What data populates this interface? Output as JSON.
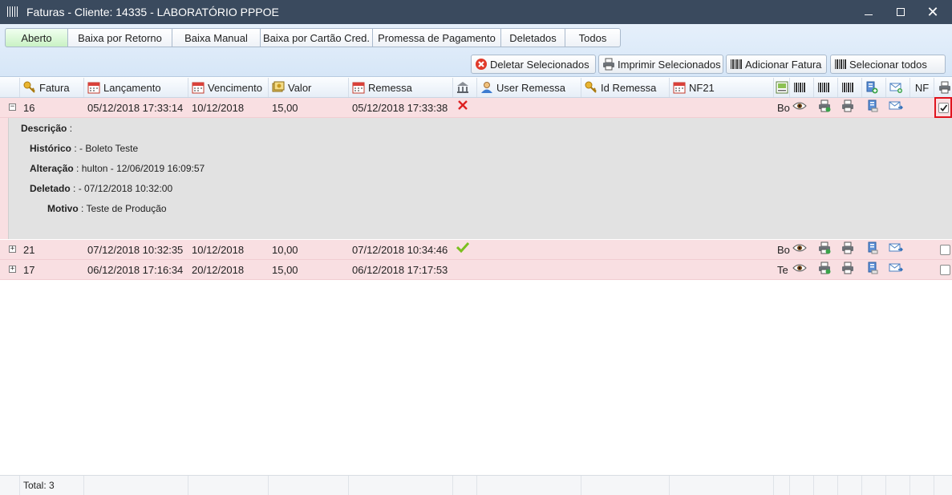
{
  "window": {
    "title": "Faturas - Cliente: 14335 - LABORATÓRIO PPPOE"
  },
  "tabs": [
    {
      "label": "Aberto",
      "active": true
    },
    {
      "label": "Baixa por Retorno"
    },
    {
      "label": "Baixa Manual"
    },
    {
      "label": "Baixa por Cartão Cred."
    },
    {
      "label": "Promessa de Pagamento"
    },
    {
      "label": "Deletados"
    },
    {
      "label": "Todos"
    }
  ],
  "actions": {
    "delete": "Deletar Selecionados",
    "print": "Imprimir Selecionados",
    "add": "Adicionar Fatura",
    "select_all": "Selecionar todos"
  },
  "columns": {
    "fatura": "Fatura",
    "lancamento": "Lançamento",
    "vencimento": "Vencimento",
    "valor": "Valor",
    "remessa": "Remessa",
    "user_remessa": "User Remessa",
    "id_remessa": "Id Remessa",
    "nf21": "NF21",
    "nf": "NF"
  },
  "rows": [
    {
      "fatura": "16",
      "lancamento": "05/12/2018 17:33:14",
      "vencimento": "10/12/2018",
      "valor": "15,00",
      "remessa": "05/12/2018 17:33:38",
      "status_icon": "red-x-icon",
      "desc_short": "Bo",
      "expanded": true,
      "checked": true
    },
    {
      "fatura": "21",
      "lancamento": "07/12/2018 10:32:35",
      "vencimento": "10/12/2018",
      "valor": "10,00",
      "remessa": "07/12/2018 10:34:46",
      "status_icon": "green-check-icon",
      "desc_short": "Bo",
      "expanded": false,
      "checked": false
    },
    {
      "fatura": "17",
      "lancamento": "06/12/2018 17:16:34",
      "vencimento": "20/12/2018",
      "valor": "15,00",
      "remessa": "06/12/2018 17:17:53",
      "status_icon": "",
      "desc_short": "Te",
      "expanded": false,
      "checked": false
    }
  ],
  "detail": {
    "descricao_label": "Descrição",
    "descricao_value": "",
    "historico_label": "Histórico",
    "historico_value": "- Boleto Teste",
    "alteracao_label": "Alteração",
    "alteracao_value": "hulton - 12/06/2019 16:09:57",
    "deletado_label": "Deletado",
    "deletado_value": "- 07/12/2018 10:32:00",
    "motivo_label": "Motivo",
    "motivo_value": "Teste de Produção"
  },
  "footer": {
    "total": "Total: 3"
  },
  "colors": {
    "titlebar": "#3a4a5e",
    "row_bg": "#f9dfe2",
    "detail_bg": "#e2e2e2",
    "active_tab": "#c9f2c4",
    "highlight": "#e0141e"
  }
}
